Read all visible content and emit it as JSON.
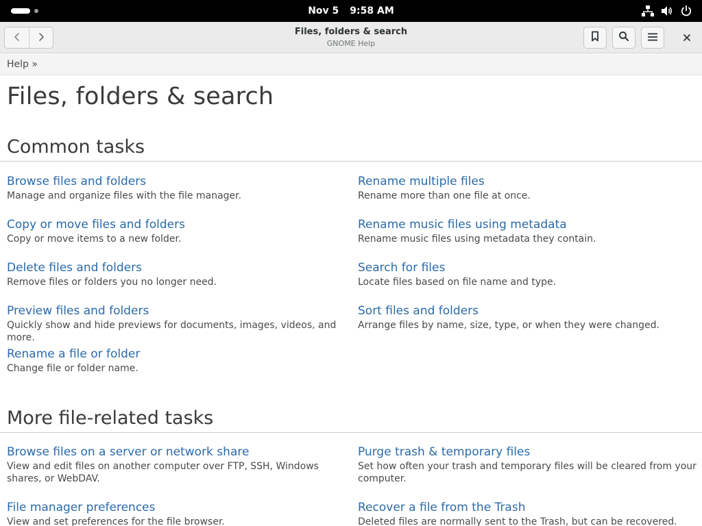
{
  "system_bar": {
    "date": "Nov 5",
    "time": "9:58 AM",
    "tray_icons": [
      "network-icon",
      "volume-icon",
      "power-icon"
    ]
  },
  "header": {
    "title": "Files, folders & search",
    "subtitle": "GNOME Help",
    "buttons": [
      "back-button",
      "forward-button",
      "bookmark-button",
      "search-button",
      "menu-button",
      "close-button"
    ]
  },
  "breadcrumb": {
    "text": "Help »"
  },
  "page": {
    "title": "Files, folders & search"
  },
  "sections": [
    {
      "title": "Common tasks",
      "items": [
        {
          "title": "Browse files and folders",
          "desc": "Manage and organize files with the file manager."
        },
        {
          "title": "Rename multiple files",
          "desc": "Rename more than one file at once."
        },
        {
          "title": "Copy or move files and folders",
          "desc": "Copy or move items to a new folder."
        },
        {
          "title": "Rename music files using metadata",
          "desc": "Rename music files using metadata they contain."
        },
        {
          "title": "Delete files and folders",
          "desc": "Remove files or folders you no longer need."
        },
        {
          "title": "Search for files",
          "desc": "Locate files based on file name and type."
        },
        {
          "title": "Preview files and folders",
          "desc": "Quickly show and hide previews for documents, images, videos, and more."
        },
        {
          "title": "Sort files and folders",
          "desc": "Arrange files by name, size, type, or when they were changed."
        },
        {
          "title": "Rename a file or folder",
          "desc": "Change file or folder name."
        }
      ]
    },
    {
      "title": "More file-related tasks",
      "items": [
        {
          "title": "Browse files on a server or network share",
          "desc": "View and edit files on another computer over FTP, SSH, Windows shares, or WebDAV."
        },
        {
          "title": "Purge trash & temporary files",
          "desc": "Set how often your trash and temporary files will be cleared from your computer."
        },
        {
          "title": "File manager preferences",
          "desc": "View and set preferences for the file browser."
        },
        {
          "title": "Recover a file from the Trash",
          "desc": "Deleted files are normally sent to the Trash, but can be recovered."
        }
      ]
    }
  ],
  "colors": {
    "link": "#2a6aa8",
    "text": "#4a4a4a",
    "headerbar": "#ebebeb",
    "system_bar": "#000000"
  }
}
